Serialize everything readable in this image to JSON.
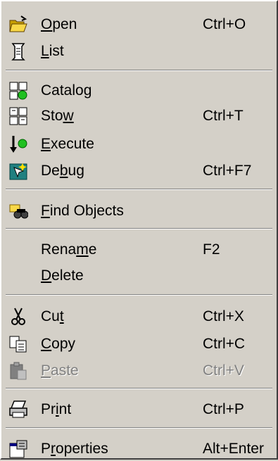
{
  "menu": {
    "items": [
      {
        "pre": "",
        "mn": "O",
        "post": "pen",
        "shortcut": "Ctrl+O",
        "icon": "folder-open-icon"
      },
      {
        "pre": "",
        "mn": "L",
        "post": "ist",
        "shortcut": "",
        "icon": "scroll-list-icon"
      },
      {
        "pre": "Catalo",
        "mn": "g",
        "post": "",
        "shortcut": "",
        "icon": "catalog-icon"
      },
      {
        "pre": "Sto",
        "mn": "w",
        "post": "",
        "shortcut": "Ctrl+T",
        "icon": "stow-icon"
      },
      {
        "pre": "",
        "mn": "E",
        "post": "xecute",
        "shortcut": "",
        "icon": "execute-icon"
      },
      {
        "pre": "De",
        "mn": "b",
        "post": "ug",
        "shortcut": "Ctrl+F7",
        "icon": "debug-icon"
      },
      {
        "pre": "",
        "mn": "F",
        "post": "ind Objects",
        "shortcut": "",
        "icon": "find-objects-icon"
      },
      {
        "pre": "Rena",
        "mn": "m",
        "post": "e",
        "shortcut": "F2",
        "icon": ""
      },
      {
        "pre": "",
        "mn": "D",
        "post": "elete",
        "shortcut": "",
        "icon": ""
      },
      {
        "pre": "Cu",
        "mn": "t",
        "post": "",
        "shortcut": "Ctrl+X",
        "icon": "scissors-icon"
      },
      {
        "pre": "",
        "mn": "C",
        "post": "opy",
        "shortcut": "Ctrl+C",
        "icon": "copy-icon"
      },
      {
        "pre": "",
        "mn": "P",
        "post": "aste",
        "shortcut": "Ctrl+V",
        "icon": "paste-icon",
        "disabled": true
      },
      {
        "pre": "Pr",
        "mn": "i",
        "post": "nt",
        "shortcut": "Ctrl+P",
        "icon": "printer-icon"
      },
      {
        "pre": "P",
        "mn": "r",
        "post": "operties",
        "shortcut": "Alt+Enter",
        "icon": "properties-icon"
      }
    ]
  },
  "colors": {
    "menu_bg": "#d4d0c8",
    "disabled_text": "#808080"
  }
}
